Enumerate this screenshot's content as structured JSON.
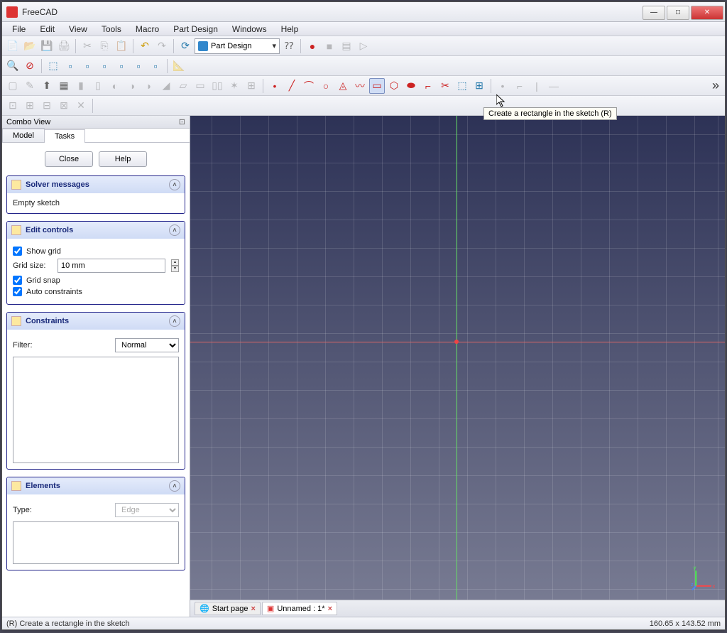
{
  "app_title": "FreeCAD",
  "menus": [
    "File",
    "Edit",
    "View",
    "Tools",
    "Macro",
    "Part Design",
    "Windows",
    "Help"
  ],
  "workbench": "Part Design",
  "tooltip": "Create a rectangle in the sketch (R)",
  "combo": {
    "title": "Combo View",
    "tabs": [
      "Model",
      "Tasks"
    ],
    "active_tab": "Tasks",
    "buttons": {
      "close": "Close",
      "help": "Help"
    }
  },
  "panels": {
    "solver": {
      "title": "Solver messages",
      "text": "Empty sketch"
    },
    "edit": {
      "title": "Edit controls",
      "show_grid": "Show grid",
      "grid_size_label": "Grid size:",
      "grid_size_value": "10 mm",
      "grid_snap": "Grid snap",
      "auto_constraints": "Auto constraints"
    },
    "constraints": {
      "title": "Constraints",
      "filter_label": "Filter:",
      "filter_value": "Normal"
    },
    "elements": {
      "title": "Elements",
      "type_label": "Type:",
      "type_value": "Edge"
    }
  },
  "doc_tabs": [
    {
      "label": "Start page",
      "icon": "globe"
    },
    {
      "label": "Unnamed : 1*",
      "icon": "freecad"
    }
  ],
  "status": {
    "left": "(R) Create a rectangle in the sketch",
    "right": "160.65 x 143.52 mm"
  },
  "axis_labels": {
    "x": "x",
    "y": "y",
    "z": "z"
  }
}
